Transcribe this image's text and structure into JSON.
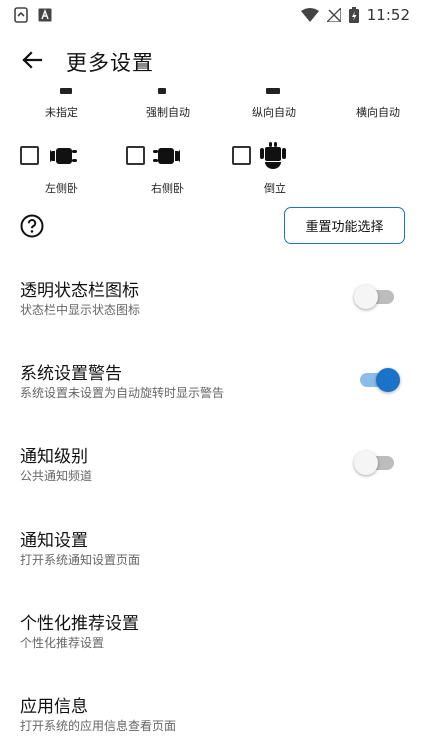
{
  "status_bar": {
    "time": "11:52",
    "icons": [
      "screenshot-icon",
      "app-notification-icon",
      "wifi-icon",
      "no-signal-icon",
      "battery-icon"
    ]
  },
  "app_bar": {
    "title": "更多设置",
    "back_icon": "arrow-back-icon"
  },
  "orientation_options_row1": [
    "未指定",
    "强制自动",
    "纵向自动",
    "横向自动"
  ],
  "orientation_options_row2": [
    {
      "label": "左侧卧",
      "checked": false,
      "icon": "android-left-icon"
    },
    {
      "label": "右侧卧",
      "checked": false,
      "icon": "android-right-icon"
    },
    {
      "label": "倒立",
      "checked": false,
      "icon": "android-upside-down-icon"
    }
  ],
  "help_icon": "help-circle-icon",
  "reset_button": "重置功能选择",
  "settings": [
    {
      "title": "透明状态栏图标",
      "subtitle": "状态栏中显示状态图标",
      "toggle": "off"
    },
    {
      "title": "系统设置警告",
      "subtitle": "系统设置未设置为自动旋转时显示警告",
      "toggle": "on"
    },
    {
      "title": "通知级别",
      "subtitle": "公共通知频道",
      "toggle": "off"
    },
    {
      "title": "通知设置",
      "subtitle": "打开系统通知设置页面"
    },
    {
      "title": "个性化推荐设置",
      "subtitle": "个性化推荐设置"
    },
    {
      "title": "应用信息",
      "subtitle": "打开系统的应用信息查看页面"
    }
  ],
  "colors": {
    "accent": "#1a73c8",
    "switch_track_on": "#8bbde8",
    "switch_track_off": "#bdbdbd"
  }
}
